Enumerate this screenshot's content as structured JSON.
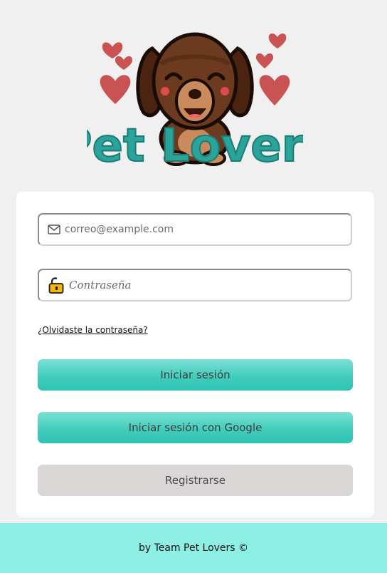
{
  "brand": {
    "logo_text": "Pet Lovers"
  },
  "login_form": {
    "email_placeholder": "correo@example.com",
    "password_placeholder": "Contraseña",
    "forgot_password": "¿Olvidaste la contraseña?",
    "login_button": "Iniciar sesión",
    "google_button": "Iniciar sesión con Google",
    "register_button": "Registrarse"
  },
  "footer": {
    "credit": "by Team Pet Lovers ©"
  },
  "colors": {
    "background": "#f0f0f0",
    "accent_teal": "#3fcbbb",
    "footer_bg": "#8ef0e4",
    "register_bg": "#dbd7d7",
    "logo_text": "#2aa39a",
    "dog_brown": "#6b3a1f",
    "heart_red": "#c95353"
  },
  "icons": {
    "email": "envelope-icon",
    "password": "lock-icon",
    "hearts": "heart-icon"
  }
}
